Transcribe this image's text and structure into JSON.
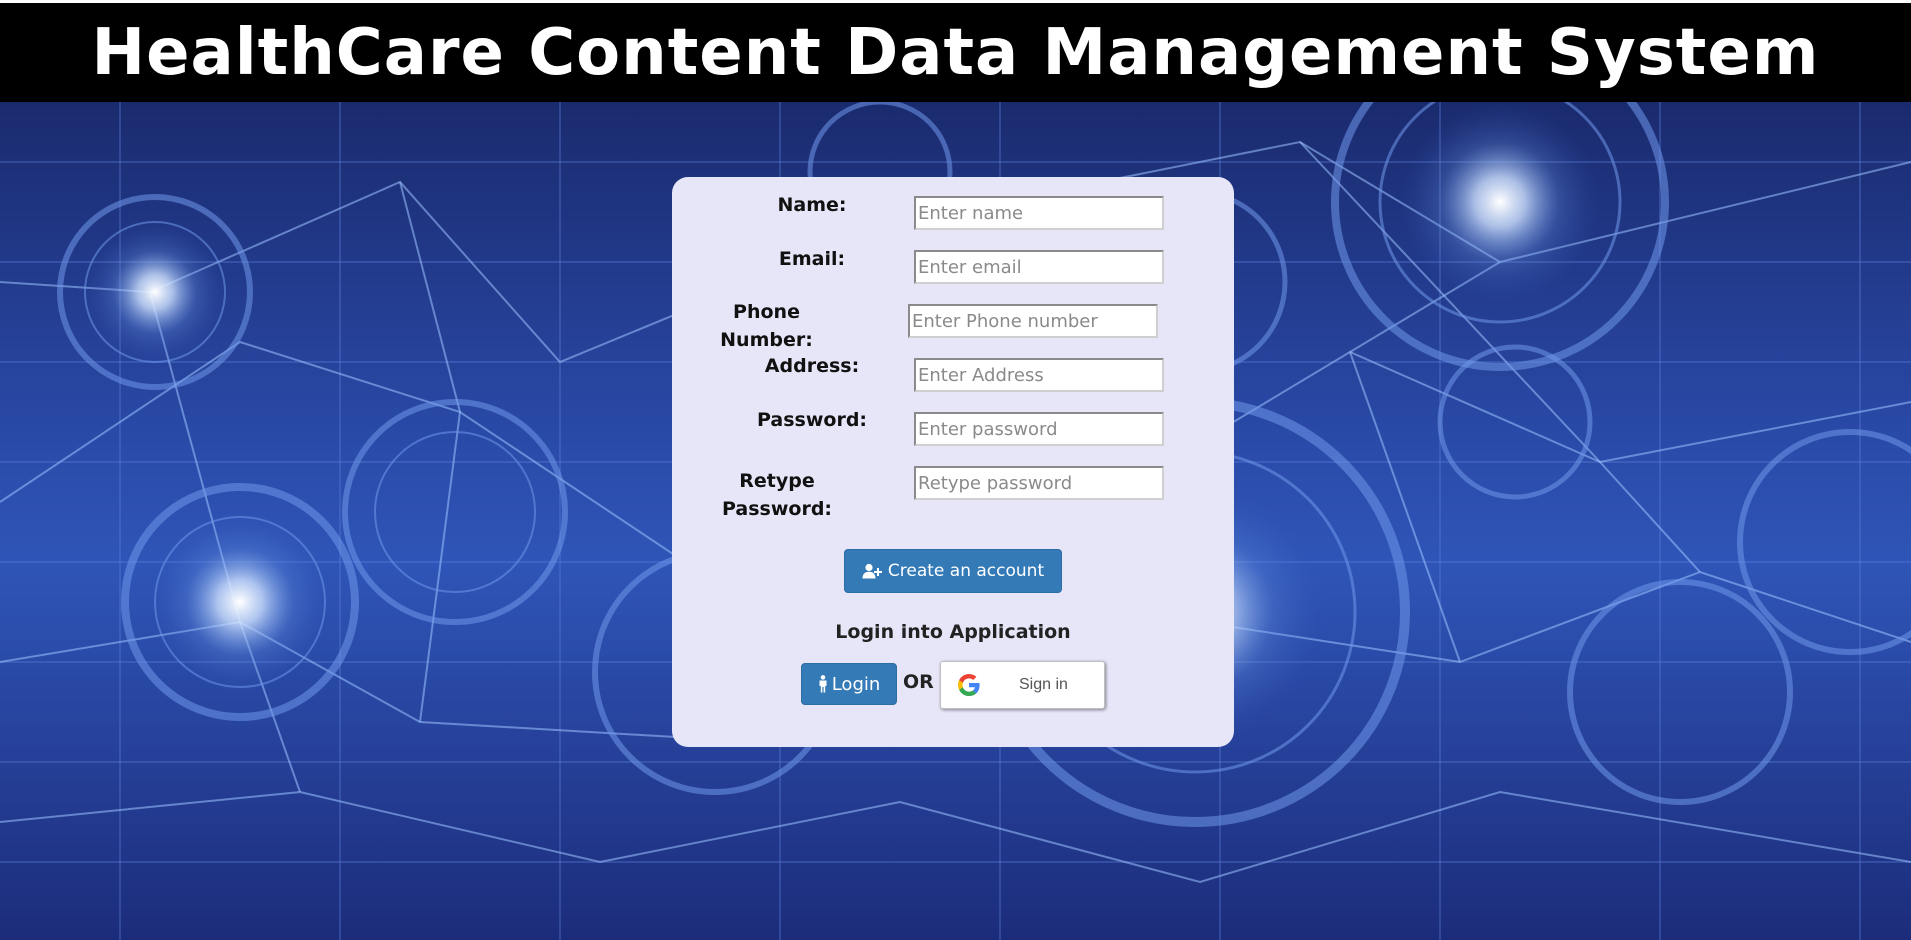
{
  "header": {
    "title": "HealthCare Content Data Management System"
  },
  "form": {
    "fields": [
      {
        "label": "Name:",
        "placeholder": "Enter name",
        "value": ""
      },
      {
        "label": "Email:",
        "placeholder": "Enter email",
        "value": ""
      },
      {
        "label": "Phone Number:",
        "placeholder": "Enter Phone number",
        "value": ""
      },
      {
        "label": "Address:",
        "placeholder": "Enter Address",
        "value": ""
      },
      {
        "label": "Password:",
        "placeholder": "Enter password",
        "value": ""
      },
      {
        "label": "Retype Password:",
        "placeholder": "Retype password",
        "value": ""
      }
    ],
    "create_button_label": "Create an account",
    "create_button_icon": "user-plus-icon",
    "login_title": "Login into Application",
    "login_button_label": "Login",
    "login_button_icon": "male-person-icon",
    "or_text": "OR",
    "google_button_label": "Sign in",
    "google_icon": "google-g-icon"
  },
  "colors": {
    "header_bg": "#000000",
    "panel_bg": "#e6e6f8",
    "button_primary": "#337ab7",
    "background_blue": "#2a4aa8"
  }
}
